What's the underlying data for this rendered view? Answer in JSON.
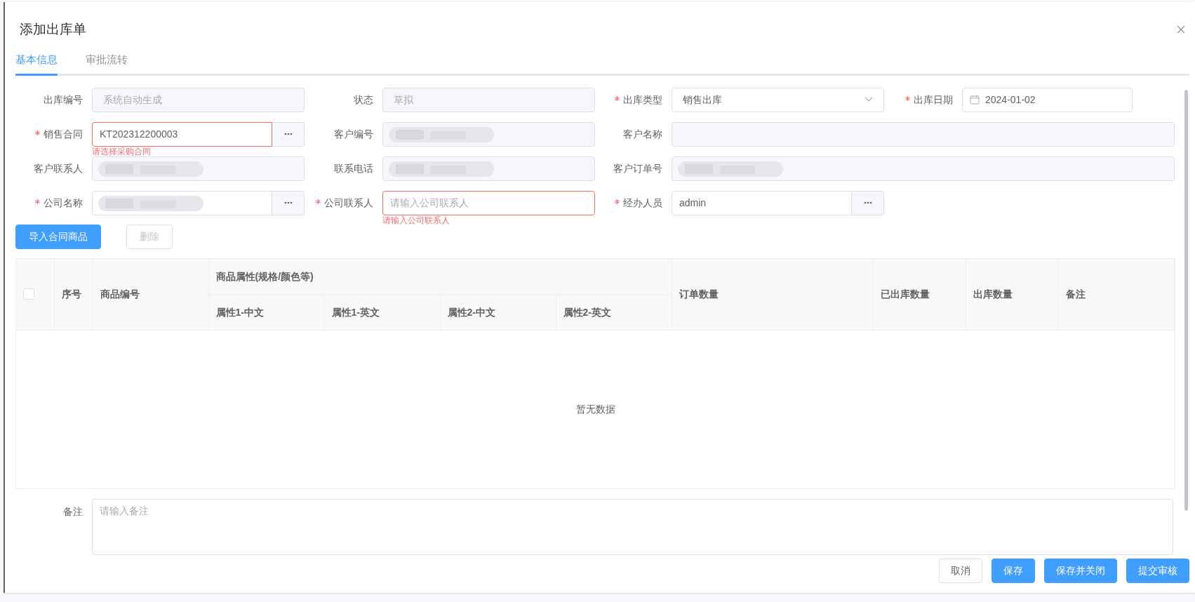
{
  "dialog": {
    "title": "添加出库单"
  },
  "tabs": [
    {
      "label": "基本信息",
      "selected": true
    },
    {
      "label": "审批流转",
      "selected": false
    }
  ],
  "form": {
    "rows": [
      [
        {
          "label": "出库编号",
          "required": false,
          "kind": "disabled",
          "placeholder": "系统自动生成"
        },
        {
          "label": "状态",
          "required": false,
          "kind": "disabled",
          "placeholder": "草拟"
        },
        {
          "label": "出库类型",
          "required": true,
          "kind": "select",
          "value": "销售出库"
        },
        {
          "label": "出库日期",
          "required": true,
          "kind": "date",
          "value": "2024-01-02"
        }
      ],
      [
        {
          "label": "销售合同",
          "required": true,
          "kind": "picker",
          "value": "KT202312200003",
          "error": "请选择采购合同"
        },
        {
          "label": "客户编号",
          "required": false,
          "kind": "disabled",
          "redacted": true
        },
        {
          "label": "客户名称",
          "required": false,
          "kind": "disabled",
          "wide": true
        }
      ],
      [
        {
          "label": "客户联系人",
          "required": false,
          "kind": "disabled",
          "redacted": true
        },
        {
          "label": "联系电话",
          "required": false,
          "kind": "disabled",
          "redacted": true
        },
        {
          "label": "客户订单号",
          "required": false,
          "kind": "disabled",
          "wide": true,
          "redacted": true
        }
      ],
      [
        {
          "label": "公司名称",
          "required": true,
          "kind": "picker",
          "redacted": true
        },
        {
          "label": "公司联系人",
          "required": true,
          "kind": "text",
          "placeholder": "请输入公司联系人",
          "error": "请输入公司联系人"
        },
        {
          "label": "经办人员",
          "required": true,
          "kind": "picker",
          "value": "admin"
        }
      ]
    ]
  },
  "actions": [
    {
      "label": "导入合同商品",
      "primary": true,
      "disabled": false
    },
    {
      "label": "删除",
      "primary": false,
      "disabled": true
    }
  ],
  "table": {
    "select_all": {
      "checked": false
    },
    "group_header": "商品属性(规格/颜色等)",
    "columns": [
      "序号",
      "商品编号",
      "订单数量",
      "已出库数量",
      "出库数量",
      "备注"
    ],
    "sub_columns": [
      "属性1-中文",
      "属性1-英文",
      "属性2-中文",
      "属性2-英文"
    ],
    "empty_text": "暂无数据"
  },
  "remarks": {
    "label": "备注",
    "placeholder": "请输入备注"
  },
  "footer_buttons": [
    {
      "label": "取消",
      "primary": false
    },
    {
      "label": "保存",
      "primary": true
    },
    {
      "label": "保存并关闭",
      "primary": true
    },
    {
      "label": "提交审核",
      "primary": true
    }
  ]
}
